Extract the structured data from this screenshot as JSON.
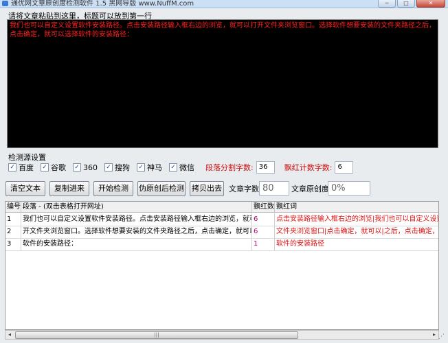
{
  "window": {
    "title": "通优网文章原创度检测软件 1.5   黑网导版 www.NuffM.com",
    "buttons": {
      "minimize": "─",
      "maximize": "□",
      "close": "✕"
    }
  },
  "input_area": {
    "hint": "请将文章粘贴到这里，标题可以放到第一行",
    "content": "我们也可以自定义设置软件安装路径。点击安装路径输入框右边的浏览，就可以打开文件夹浏览窗口。选择软件想要安装的文件夹路径之后，点击确定，就可以选择软件的安装路径："
  },
  "sources": {
    "title": "检测源设置",
    "items": [
      {
        "label": "百度",
        "checked": true
      },
      {
        "label": "谷歌",
        "checked": true
      },
      {
        "label": "360",
        "checked": true
      },
      {
        "label": "搜狗",
        "checked": true
      },
      {
        "label": "神马",
        "checked": true
      },
      {
        "label": "微信",
        "checked": true
      }
    ],
    "segment_label": "段落分割字数:",
    "segment_value": "36",
    "red_label": "飘红计数字数:",
    "red_value": "6"
  },
  "toolbar": {
    "clear": "清空文本",
    "copy": "复制进来",
    "start": "开始检测",
    "fake_original": "伪原创后检测",
    "export": "拷贝出去",
    "word_count_label": "文章字数:",
    "word_count_value": "80",
    "originality_label": "文章原创度:",
    "originality_value": "0%"
  },
  "table": {
    "headers": [
      "编号",
      "段落 - (双击表格打开网址)",
      "飘红数",
      "飘红词"
    ],
    "rows": [
      {
        "id": "1",
        "paragraph": "我们也可以自定义设置软件安装路径。点击安装路径输入框右边的浏览，就可以打",
        "count": "6",
        "words": "点击安装路径输入框右边的浏览|我们也可以自定义设置|"
      },
      {
        "id": "2",
        "paragraph": "开文件夹浏览窗口。选择软件想要安装的文件夹路径之后，点击确定，就可以选择",
        "count": "6",
        "words": "文件夹浏览窗口|点击确定，就可以|之后，点击确定，就"
      },
      {
        "id": "3",
        "paragraph": "软件的安装路径：",
        "count": "1",
        "words": "软件的安装路径"
      }
    ]
  },
  "scrollbar": {
    "left": "◂",
    "right": "▸",
    "thumb": "|||"
  },
  "colors": {
    "red_text": "#ff2020",
    "count_text": "#b0006a",
    "textarea_bg": "#000000"
  }
}
